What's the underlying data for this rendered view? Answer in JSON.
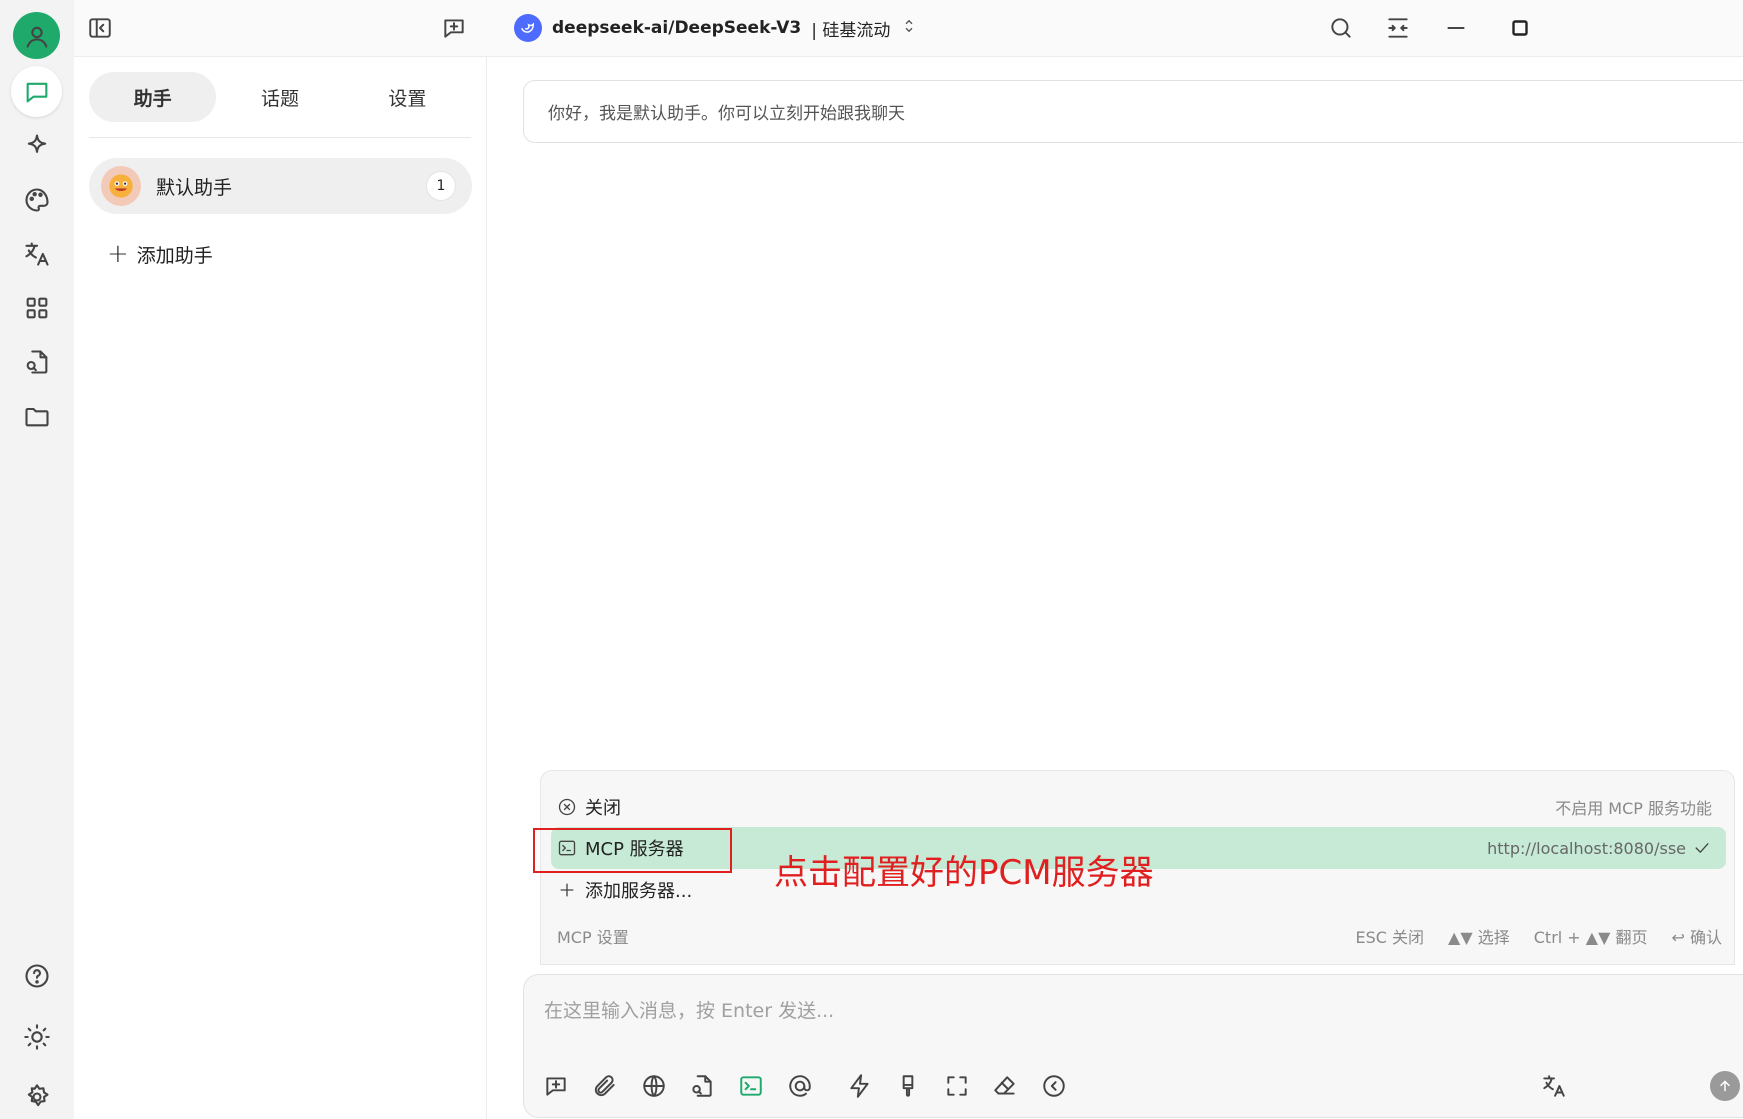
{
  "app": {
    "model": "deepseek-ai/DeepSeek-V3",
    "provider": "| 硅基流动"
  },
  "rail": {
    "items": [
      {
        "icon": "chat-bubble-icon",
        "active": true
      },
      {
        "icon": "sparkle-icon",
        "active": false
      },
      {
        "icon": "palette-icon",
        "active": false
      },
      {
        "icon": "translate-icon",
        "active": false
      },
      {
        "icon": "apps-grid-icon",
        "active": false
      },
      {
        "icon": "file-search-icon",
        "active": false
      },
      {
        "icon": "folder-icon",
        "active": false
      }
    ],
    "bottom": [
      "help-icon",
      "theme-toggle-icon",
      "settings-gear-icon"
    ]
  },
  "panel": {
    "tabs": [
      {
        "label": "助手",
        "active": true
      },
      {
        "label": "话题",
        "active": false
      },
      {
        "label": "设置",
        "active": false
      }
    ],
    "assistants": [
      {
        "name": "默认助手",
        "count": "1"
      }
    ],
    "add_assistant": "添加助手"
  },
  "chat": {
    "welcome": "你好，我是默认助手。你可以立刻开始跟我聊天"
  },
  "mcp_popup": {
    "rows": [
      {
        "icon": "close-circle-icon",
        "label": "关闭",
        "right": "不启用 MCP 服务功能",
        "selected": false
      },
      {
        "icon": "terminal-icon",
        "label": "MCP 服务器",
        "right": "http://localhost:8080/sse",
        "selected": true
      },
      {
        "icon": "plus-icon",
        "label": "添加服务器...",
        "right": "",
        "selected": false
      }
    ],
    "footer_title": "MCP 设置",
    "hints": [
      "ESC 关闭",
      "▲▼ 选择",
      "Ctrl + ▲▼ 翻页",
      "↩ 确认"
    ]
  },
  "annotation": "点击配置好的PCM服务器",
  "input": {
    "placeholder": "在这里输入消息，按 Enter 发送..."
  },
  "colors": {
    "accent": "#1faa6b",
    "annotation": "#e02020",
    "selected_row": "#c6ead6"
  }
}
